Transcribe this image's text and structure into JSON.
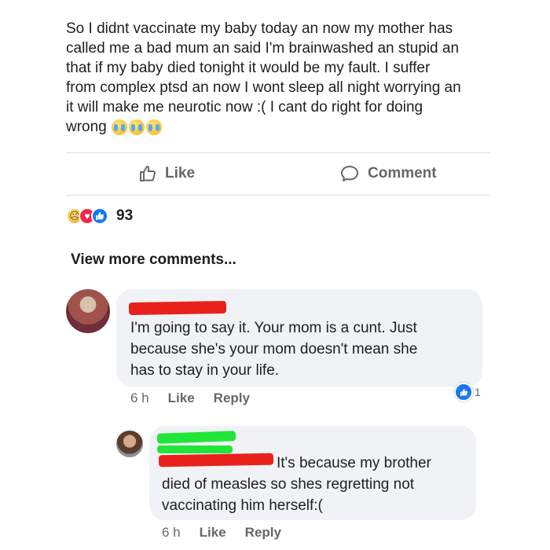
{
  "post": {
    "text": "So I didnt vaccinate my baby today an now my mother has\ncalled me a bad mum an said I'm brainwashed an stupid an\nthat if my baby died tonight it would be my fault. I suffer\nfrom complex ptsd an now I wont sleep all night worrying an\nit will make me neurotic now :( I cant do right for doing\nwrong",
    "emojis": [
      "crying-face",
      "crying-face",
      "crying-face"
    ]
  },
  "actions": {
    "like_label": "Like",
    "comment_label": "Comment"
  },
  "reactions": {
    "types": [
      "sad",
      "love",
      "like"
    ],
    "count": "93"
  },
  "view_more": "View more comments...",
  "comments": [
    {
      "author_redacted": true,
      "redaction_color": "#e8221b",
      "text": "I'm going to say it. Your mom is a cunt. Just\nbecause she's your mom doesn't mean she\nhas to stay in your life.",
      "time": "6 h",
      "like_label": "Like",
      "reply_label": "Reply",
      "like_count": "1"
    },
    {
      "author_redacted": true,
      "redaction_colors": [
        "#22e53a",
        "#e8221b"
      ],
      "text": "It's because my brother\ndied of measles so shes regretting not\nvaccinating him herself:(",
      "time": "6 h",
      "like_label": "Like",
      "reply_label": "Reply"
    }
  ],
  "colors": {
    "text": "#1c1e21",
    "secondary": "#65676b",
    "bubble": "#f0f2f5",
    "divider": "#dadde1",
    "like_blue": "#1877f2",
    "love_red": "#f0284a"
  }
}
